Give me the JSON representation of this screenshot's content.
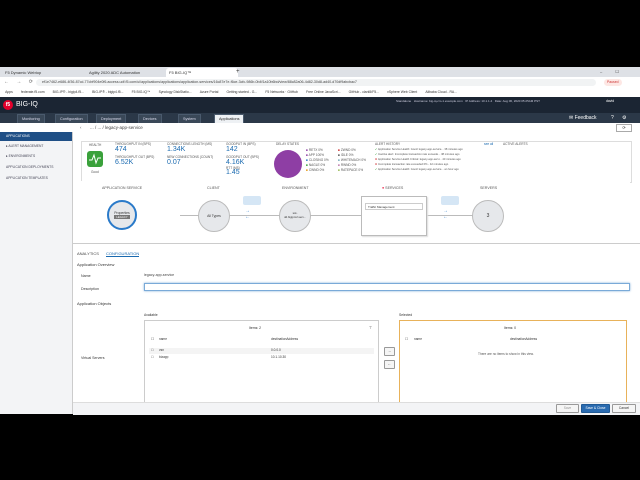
{
  "browser": {
    "tabs": [
      "F5 Dynamic Webtop",
      "Agility 2020 ADC Automation",
      "F5 BIG-IQ™"
    ],
    "url": "ef1e7462-e686-4f36-87cd-77cbf904e0f6.access.udf.f5.com/ui/applications/applications/application-services/16c87e7e-f6ce-3cfc-986b-0b4f1a10b6bd/view/88c82a06-4d82-30d8-ad40-d70df9abcbac7",
    "profile_label": "Paused",
    "bookmarks": [
      "Apps",
      "federate.f5.com",
      "BIG-IP® - bigip4.f5...",
      "BIG-IP® - bigip4.f5...",
      "F5 BIG-IQ™",
      "Synology DiskStatio...",
      "Azure Portal",
      "Getting started - G...",
      "F5 Networks · GitHub",
      "Free Online JavaScri...",
      "GitHub - clark5/F5...",
      "vSphere Web Client",
      "Alibaba Cloud - RA..."
    ]
  },
  "app": {
    "product": "BIG-IQ",
    "header_info": [
      "Standalone",
      "Hostname: big-iq-cm-1.example.com",
      "IP Address: 10.1.1.4",
      "Date: Aug 06, 2020 05:25AM PST"
    ],
    "user": "david",
    "nav_tabs": [
      "Monitoring",
      "Configuration",
      "Deployment",
      "Devices",
      "System",
      "Applications"
    ],
    "feedback": "Feedback"
  },
  "sidebar": {
    "items": [
      "APPLICATIONS",
      "ALERT MANAGEMENT",
      "ENVIRONMENTS",
      "APPLICATION DEPLOYMENTS",
      "APPLICATION TEMPLATES"
    ]
  },
  "breadcrumb": "... / ... / legacy-app-service",
  "summary": {
    "health_label": "HEALTH",
    "health_status": "Good",
    "stats": [
      {
        "label": "THROUGHPUT IN (BPS)",
        "value": "474"
      },
      {
        "label": "THROUGHPUT OUT (BPS)",
        "value": "6.52K"
      },
      {
        "label": "CONNECTIONS LENGTH (MS)",
        "value": "1.34K"
      },
      {
        "label": "NEW CONNECTIONS (COUNT)",
        "value": "0.07"
      },
      {
        "label": "GOODPUT IN (BPS)",
        "value": "142"
      },
      {
        "label": "GOODPUT OUT (BPS)",
        "value": "4.16K"
      },
      {
        "label": "RTT (MS)",
        "value": "1.45"
      }
    ],
    "delay_title": "DELAY STATES",
    "delay_items": [
      "RETX 0%",
      "APP 100%",
      "CLOSING 0%",
      "NAGLE 0%",
      "CWND 0%",
      "ZWND 0%",
      "IDLE 0%",
      "WHITEMACH 0%",
      "RWND 0%",
      "RATEPACE 0%"
    ],
    "alert_title": "ALERT HISTORY",
    "alert_link": "see all",
    "alerts": [
      {
        "text": "Application Service Health: Good: legacy-app-service...",
        "time": "38 minutes ago"
      },
      {
        "text": "Inactive alert: Incomplete transaction rate exceede...",
        "time": "38 minutes ago"
      },
      {
        "text": "Application Service Health Critical: legacy-app-servi...",
        "time": "40 minutes ago"
      },
      {
        "text": "Incomplete transaction rate exceeded 0% - 42 minutes ago",
        "time": ""
      },
      {
        "text": "Application Service Health: Good: legacy-app-service...",
        "time": "an hour ago"
      }
    ],
    "active_alerts_title": "ACTIVE ALERTS"
  },
  "topology": {
    "labels": [
      "APPLICATION SERVICE",
      "CLIENT",
      "ENVIRONMENT",
      "SERVICES",
      "SERVERS"
    ],
    "app_node": "Properties",
    "app_badge": "LEGACY",
    "client_node": "All Types",
    "env_node_line1": "ssl-",
    "env_node_line2": "dd.bigipm2.serv...",
    "services_box": "Traffic Management",
    "servers_count": "3"
  },
  "config": {
    "tabs": [
      "ANALYTICS",
      "CONFIGURATION"
    ],
    "overview_title": "Application Overview",
    "name_label": "Name",
    "name_value": "legacy-app-service",
    "description_label": "Description",
    "description_value": "",
    "objects_title": "Application Objects",
    "virtual_servers_label": "Virtual Servers",
    "available": {
      "title": "Available",
      "items_label": "Items: 2",
      "columns": [
        "name",
        "destinationAddress"
      ],
      "rows": [
        [
          "vsn",
          "0.0.0.0"
        ],
        [
          "bizapp",
          "10.1.10.30"
        ]
      ]
    },
    "selected": {
      "title": "Selected",
      "items_label": "Items: 0",
      "columns": [
        "name",
        "destinationAddress"
      ],
      "empty_message": "There are no items to show in this view."
    },
    "arrows": [
      "→",
      "←"
    ]
  },
  "footer": {
    "buttons": [
      "Save",
      "Save & Close",
      "Cancel"
    ]
  }
}
